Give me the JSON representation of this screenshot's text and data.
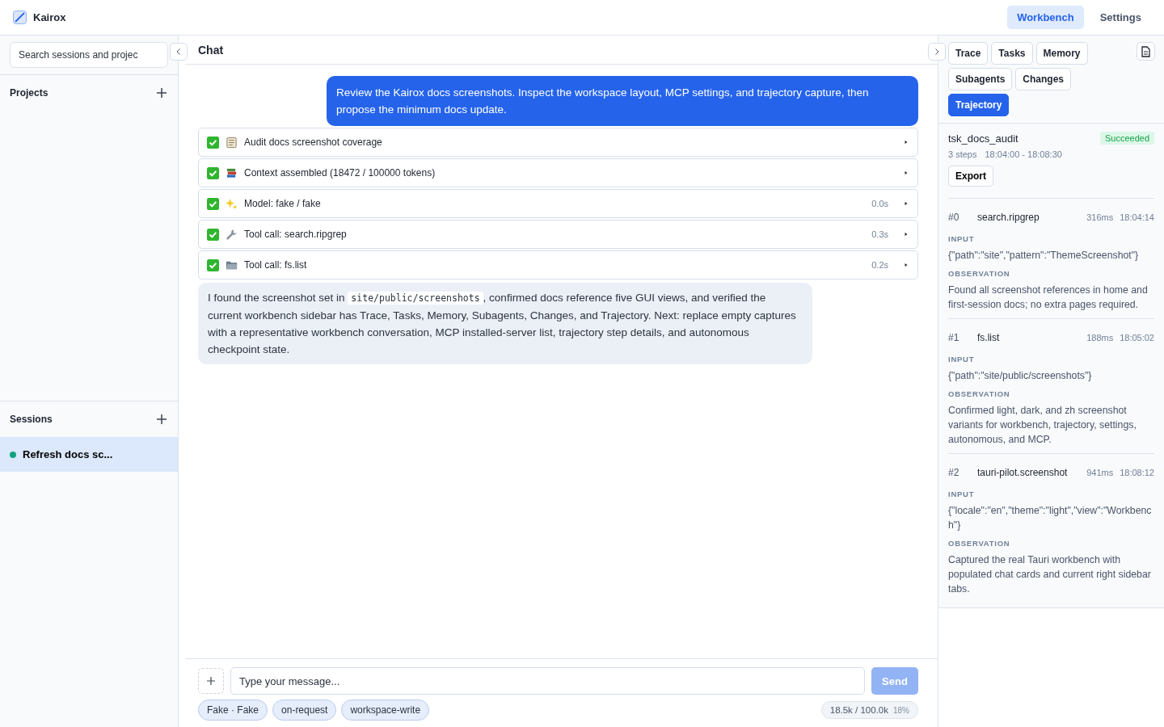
{
  "app": {
    "name": "Kairox"
  },
  "nav": [
    {
      "label": "Workbench",
      "selected": true
    },
    {
      "label": "Settings",
      "selected": false
    }
  ],
  "sidebar": {
    "search": {
      "placeholder": "Search sessions and projec"
    },
    "projects": {
      "title": "Projects"
    },
    "sessions": {
      "title": "Sessions",
      "items": [
        {
          "label": "Refresh docs sc...",
          "selected": true,
          "color": "#10a37f"
        }
      ]
    }
  },
  "chat": {
    "title": "Chat",
    "user_message": "Review the Kairox docs screenshots. Inspect the workspace layout, MCP settings, and trajectory capture, then propose the minimum docs update.",
    "trace": [
      {
        "kind": "checklist",
        "done": true,
        "label": "Audit docs screenshot coverage"
      },
      {
        "kind": "books",
        "done": true,
        "label": "Context assembled (18472 / 100000 tokens)"
      },
      {
        "kind": "sparkle",
        "done": true,
        "label": "Model: fake / fake",
        "duration": "0.0s"
      },
      {
        "kind": "wrench",
        "done": true,
        "label": "Tool call: search.ripgrep",
        "duration": "0.3s"
      },
      {
        "kind": "folder",
        "done": true,
        "label": "Tool call: fs.list",
        "duration": "0.2s"
      }
    ],
    "assistant_message": {
      "before": "I found the screenshot set in ",
      "code": "site/public/screenshots",
      "after": ", confirmed docs reference five GUI views, and verified the current workbench sidebar has Trace, Tasks, Memory, Subagents, Changes, and Trajectory. Next: replace empty captures with a representative workbench conversation, MCP installed-server list, trajectory step details, and autonomous checkpoint state."
    },
    "composer": {
      "placeholder": "Type your message...",
      "send": "Send",
      "send_disabled": true,
      "chips": [
        "Fake · Fake",
        "on-request",
        "workspace-write"
      ],
      "usage": "18.5k / 100.0k",
      "usage_percent": "18%"
    }
  },
  "panel": {
    "tabs": [
      {
        "label": "Trace",
        "selected": false
      },
      {
        "label": "Tasks",
        "selected": false
      },
      {
        "label": "Memory",
        "selected": false
      },
      {
        "label": "Subagents",
        "selected": false
      },
      {
        "label": "Changes",
        "selected": false
      },
      {
        "label": "Trajectory",
        "selected": true
      }
    ],
    "trajectory": {
      "id": "tsk_docs_audit",
      "status": "Succeeded",
      "steps_count": "3 steps",
      "range": "18:04:00 - 18:08:30",
      "export": "Export",
      "steps": [
        {
          "index": "#0",
          "name": "search.ripgrep",
          "ms": "316ms",
          "time": "18:04:14",
          "input_label": "INPUT",
          "input": "{\"path\":\"site\",\"pattern\":\"ThemeScreenshot\"}",
          "observation_label": "OBSERVATION",
          "observation": "Found all screenshot references in home and first-session docs; no extra pages required."
        },
        {
          "index": "#1",
          "name": "fs.list",
          "ms": "188ms",
          "time": "18:05:02",
          "input_label": "INPUT",
          "input": "{\"path\":\"site/public/screenshots\"}",
          "observation_label": "OBSERVATION",
          "observation": "Confirmed light, dark, and zh screenshot variants for workbench, trajectory, settings, autonomous, and MCP."
        },
        {
          "index": "#2",
          "name": "tauri-pilot.screenshot",
          "ms": "941ms",
          "time": "18:08:12",
          "input_label": "INPUT",
          "input": "{\"locale\":\"en\",\"theme\":\"light\",\"view\":\"Workbench\"}",
          "observation_label": "OBSERVATION",
          "observation": "Captured the real Tauri workbench with populated chat cards and current right sidebar tabs."
        }
      ]
    }
  }
}
